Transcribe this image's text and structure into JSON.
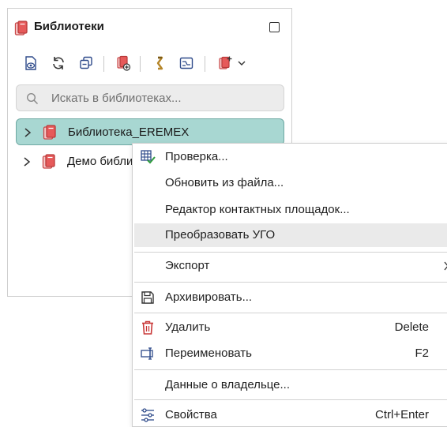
{
  "panel": {
    "title": "Библиотеки",
    "title_icon": "library-books-icon",
    "toolbar": [
      {
        "name": "view-library-icon"
      },
      {
        "name": "refresh-icon"
      },
      {
        "name": "collapse-all-icon"
      },
      {
        "name": "add-library-icon"
      },
      {
        "name": "link-icon"
      },
      {
        "name": "schematic-symbol-icon"
      },
      {
        "name": "import-library-icon"
      },
      {
        "name": "chevron-down-icon"
      }
    ],
    "search_placeholder": "Искать в библиотеках...",
    "tree": [
      {
        "label": "Библиотека_EREMEX",
        "selected": true
      },
      {
        "label": "Демо библи",
        "selected": false
      }
    ]
  },
  "context_menu": {
    "items": [
      {
        "label": "Проверка...",
        "icon": "check-table-icon"
      },
      {
        "label": "Обновить из файла..."
      },
      {
        "label": "Редактор контактных площадок..."
      },
      {
        "label": "Преобразовать УГО",
        "highlighted": true
      },
      {
        "label": "Экспорт",
        "submenu": true
      },
      {
        "label": "Архивировать...",
        "icon": "save-archive-icon"
      },
      {
        "label": "Удалить",
        "icon": "trash-icon",
        "shortcut": "Delete"
      },
      {
        "label": "Переименовать",
        "icon": "rename-icon",
        "shortcut": "F2"
      },
      {
        "label": "Данные о владельце..."
      },
      {
        "label": "Свойства",
        "icon": "settings-sliders-icon",
        "shortcut": "Ctrl+Enter"
      }
    ]
  },
  "colors": {
    "selected_row": "#a8d7d2",
    "menu_hover": "#eaeaea",
    "library_icon_red": "#d84a4a"
  }
}
